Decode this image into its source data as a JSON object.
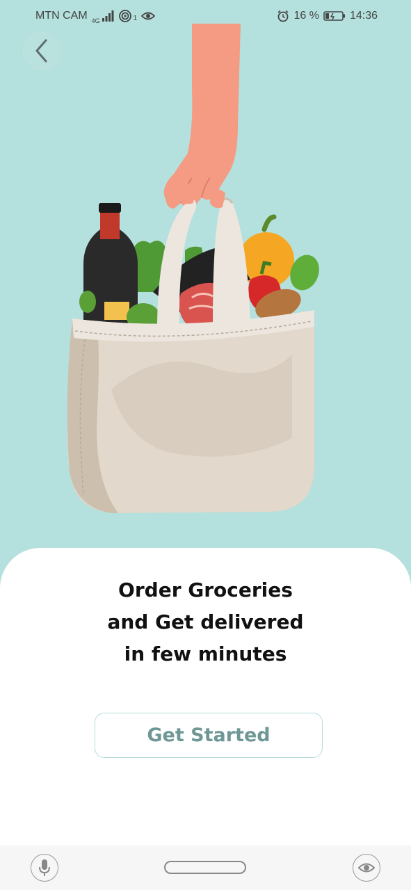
{
  "status_bar": {
    "carrier": "MTN CAM",
    "network_type": "4G",
    "notification_count": "1",
    "battery_percent": "16 %",
    "time": "14:36"
  },
  "colors": {
    "background": "#b4e0dd",
    "button_text": "#6e9796",
    "button_border": "#b5dcdc",
    "headline": "#111111"
  },
  "hero": {
    "icon": "grocery-bag-illustration"
  },
  "headline": {
    "line1": "Order Groceries",
    "line2": "and Get delivered",
    "line3": "in few minutes"
  },
  "cta": {
    "label": "Get Started"
  },
  "icons": {
    "back": "chevron-left-icon",
    "mic": "microphone-icon",
    "home": "home-pill",
    "eye": "eye-icon"
  }
}
